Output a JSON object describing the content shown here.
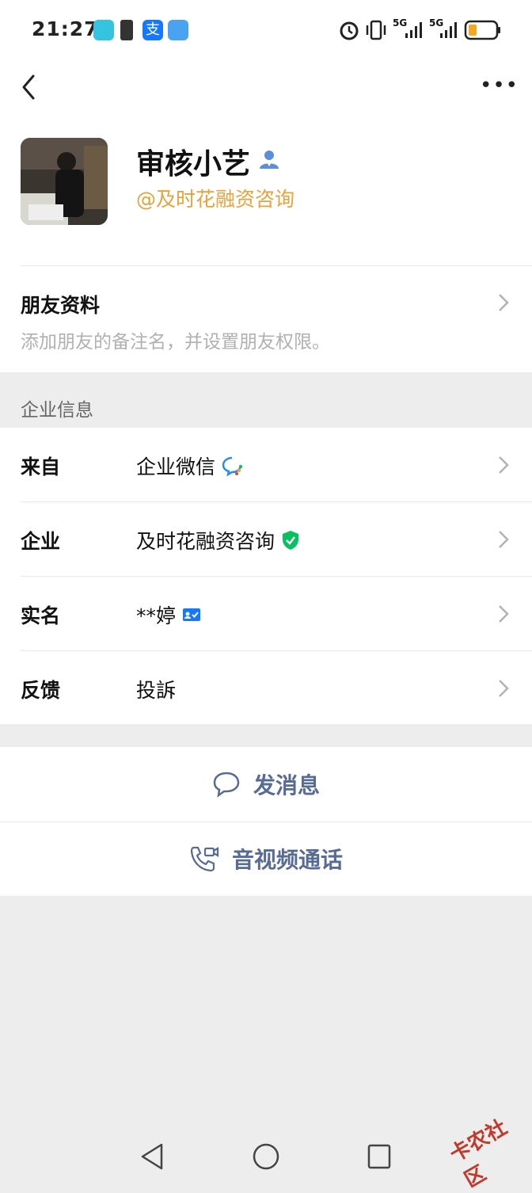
{
  "status": {
    "time": "21:27",
    "network1": "5G",
    "network2": "5G"
  },
  "nav": {
    "back_label": "back",
    "more_glyph": "•••"
  },
  "profile": {
    "name": "审核小艺",
    "org_handle": "@及时花融资咨询"
  },
  "friend_info": {
    "title": "朋友资料",
    "subtitle": "添加朋友的备注名，并设置朋友权限。"
  },
  "section_label": "企业信息",
  "info_rows": [
    {
      "label": "来自",
      "value": "企业微信"
    },
    {
      "label": "企业",
      "value": "及时花融资咨询"
    },
    {
      "label": "实名",
      "value": "**婷"
    },
    {
      "label": "反馈",
      "value": "投訴"
    }
  ],
  "actions": {
    "message": "发消息",
    "call": "音视频通话"
  },
  "watermark": "卡农社区",
  "colors": {
    "accent": "#576b95",
    "org": "#e6a23c",
    "verified": "#07c160",
    "icon_blue": "#1677ff"
  }
}
